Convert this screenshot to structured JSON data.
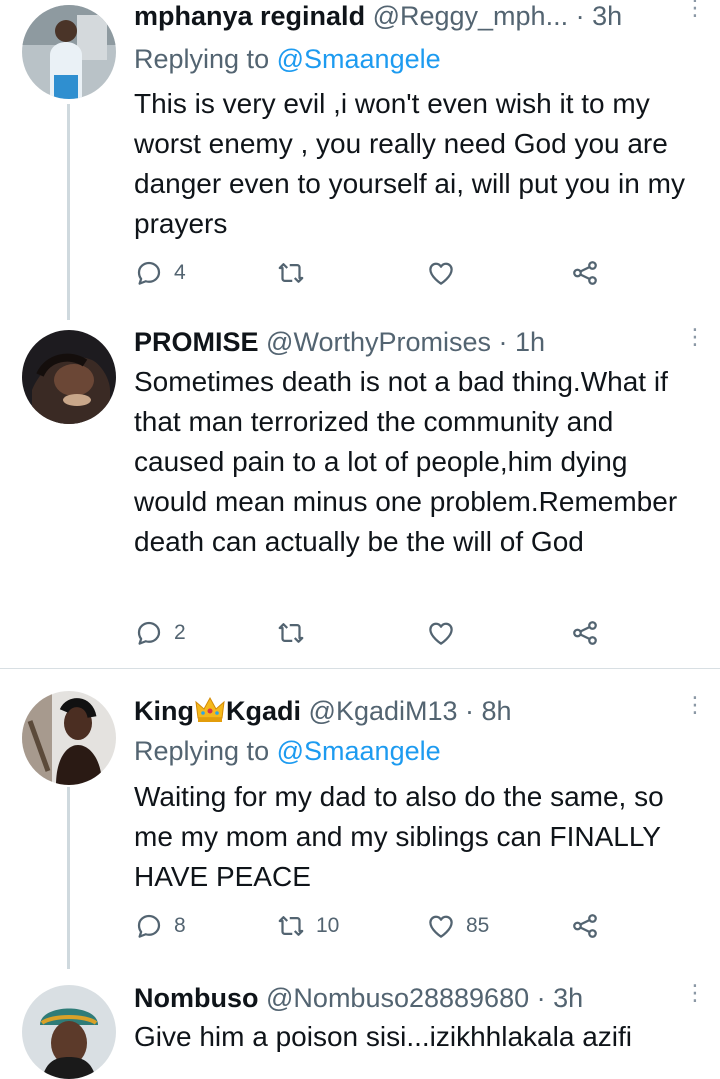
{
  "tweets": [
    {
      "name": "mphanya reginald",
      "handle": "@Reggy_mph...",
      "time": "· 3h",
      "reply_label": "Replying to",
      "reply_to": "@Smaangele",
      "text": "This is very evil ,i won't even wish it to my worst enemy , you really need God you are danger even to yourself ai, will put you in my prayers",
      "replies": "4",
      "retweets": "",
      "likes": ""
    },
    {
      "name": "PROMISE",
      "handle": "@WorthyPromises",
      "time": "· 1h",
      "text": "Sometimes death is not a bad thing.What if that man terrorized the community and caused pain to a lot of people,him dying would mean minus one problem.Remember death can actually be the will of God",
      "replies": "2",
      "retweets": "",
      "likes": ""
    },
    {
      "name_part1": "King",
      "name_part2": "Kgadi",
      "handle": "@KgadiM13",
      "time": "· 8h",
      "reply_label": "Replying to",
      "reply_to": "@Smaangele",
      "text": "Waiting for my dad to also do the same, so me my mom and my siblings can FINALLY HAVE PEACE",
      "replies": "8",
      "retweets": "10",
      "likes": "85"
    },
    {
      "name": "Nombuso",
      "handle": "@Nombuso28889680",
      "time": "· 3h",
      "text": "Give him a poison sisi...izikhhlakala azifi"
    }
  ],
  "icons": {
    "reply": "reply-icon",
    "retweet": "retweet-icon",
    "like": "heart-icon",
    "share": "share-icon",
    "more": "more-options-icon",
    "crown": "crown-emoji-icon"
  },
  "colors": {
    "link": "#1d9bf0",
    "secondary_text": "#536471",
    "thread_line": "#cfd9de"
  }
}
